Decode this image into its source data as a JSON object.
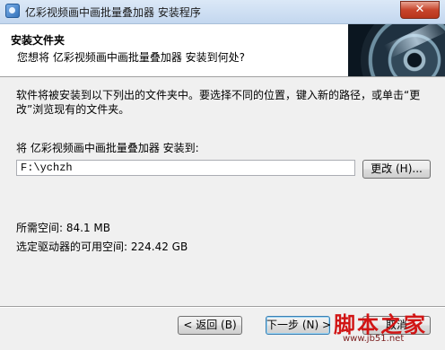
{
  "window": {
    "title": "亿彩视频画中画批量叠加器 安装程序",
    "close_label": "✕"
  },
  "header": {
    "title": "安装文件夹",
    "subtitle": "您想将 亿彩视频画中画批量叠加器 安装到何处?"
  },
  "main": {
    "description": "软件将被安装到以下列出的文件夹中。要选择不同的位置，键入新的路径，或单击“更改”浏览现有的文件夹。",
    "install_label": "将 亿彩视频画中画批量叠加器 安装到:",
    "path_value": "F:\\ychzh",
    "browse_label": "更改 (H)...",
    "space_required": "所需空间: 84.1 MB",
    "space_available": "选定驱动器的可用空间: 224.42 GB"
  },
  "footer": {
    "back_label": "< 返回 (B)",
    "next_label": "下一步 (N) >",
    "cancel_label": "取消"
  },
  "watermark": {
    "main": "脚本之家",
    "url": "www.jb51.net"
  }
}
